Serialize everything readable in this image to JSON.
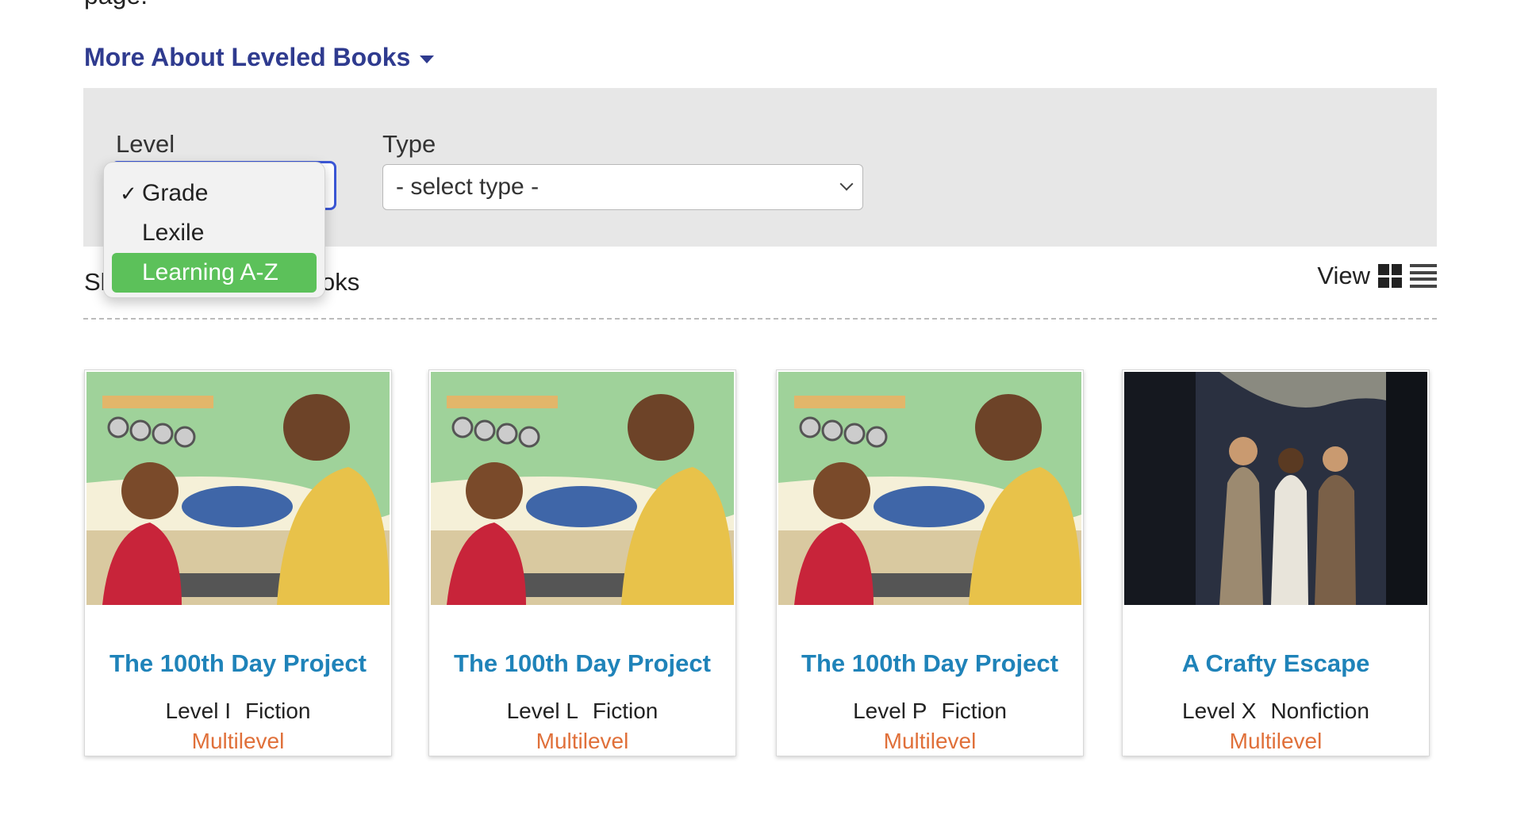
{
  "page_fragment": "page.",
  "more_about": "More About Leveled Books",
  "filters": {
    "level_label": "Level",
    "type_label": "Type",
    "type_placeholder": "- select type -",
    "level_options": [
      {
        "label": "Grade",
        "checked": true,
        "highlighted": false
      },
      {
        "label": "Lexile",
        "checked": false,
        "highlighted": false
      },
      {
        "label": "Learning A-Z",
        "checked": false,
        "highlighted": true
      }
    ]
  },
  "results": {
    "showing_prefix": "Sl",
    "showing_suffix": ") books",
    "view_label": "View"
  },
  "colors": {
    "link_blue": "#2f3b8f",
    "title_blue": "#1f83b9",
    "multilevel_orange": "#e0703a",
    "highlight_green": "#5cc15a",
    "focus_blue": "#3b57d6"
  },
  "books": [
    {
      "title": "The 100th Day Project",
      "level": "Level I",
      "genre": "Fiction",
      "tag": "Multilevel"
    },
    {
      "title": "The 100th Day Project",
      "level": "Level L",
      "genre": "Fiction",
      "tag": "Multilevel"
    },
    {
      "title": "The 100th Day Project",
      "level": "Level P",
      "genre": "Fiction",
      "tag": "Multilevel"
    },
    {
      "title": "A Crafty Escape",
      "level": "Level X",
      "genre": "Nonfiction",
      "tag": "Multilevel"
    }
  ]
}
